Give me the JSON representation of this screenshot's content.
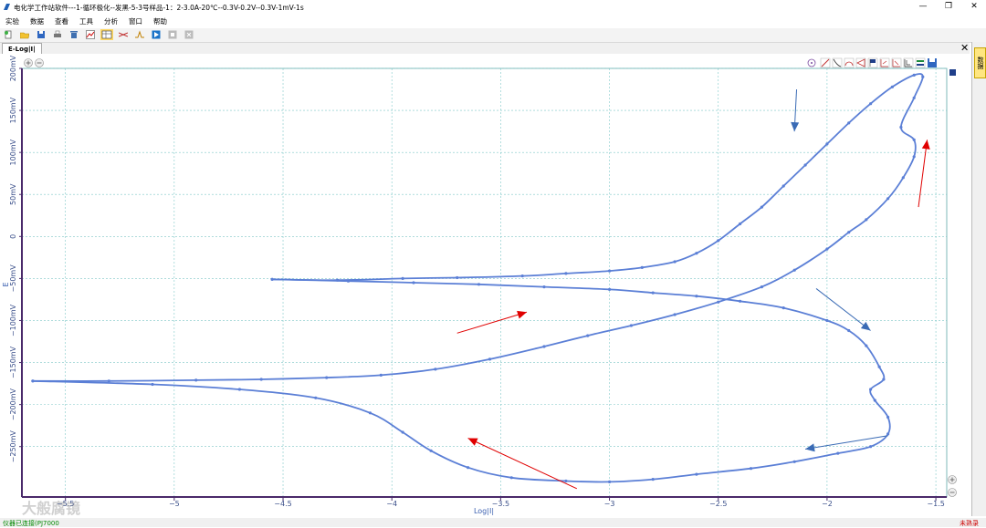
{
  "window": {
    "title": "电化学工作站软件---1-循环极化--发黑-5-3号样品-1：2-3.0A-20℃--0.3V-0.2V--0.3V-1mV-1s",
    "minimize_glyph": "—",
    "restore_glyph": "❐",
    "close_glyph": "✕"
  },
  "menu": [
    "实验",
    "数据",
    "查看",
    "工具",
    "分析",
    "窗口",
    "帮助"
  ],
  "toolbar_icons": [
    "new-icon",
    "open-folder-icon",
    "save-icon",
    "print-icon",
    "delete-icon",
    "chart-icon",
    "table-icon",
    "fit-icon",
    "peak-icon",
    "run-icon",
    "stop-icon",
    "close-file-icon"
  ],
  "tab": {
    "label": "E-Log|I|",
    "close_glyph": "✕"
  },
  "side_panel": {
    "label": "数据"
  },
  "watermark": "大般腐镜",
  "status": {
    "left": "仪器已连接(PJ7000",
    "right": "未熟录"
  },
  "chart_data": {
    "type": "line",
    "xlabel": "Log|I|",
    "ylabel": "E",
    "xlim": [
      -5.7,
      -1.45
    ],
    "ylim": [
      -310,
      200
    ],
    "x_ticks": [
      -5.5,
      -5,
      -4.5,
      -4,
      -3.5,
      -3,
      -2.5,
      -2,
      -1.5
    ],
    "x_tick_labels": [
      "−5.5",
      "−5",
      "−4.5",
      "−4",
      "−3.5",
      "−3",
      "−2.5",
      "−2",
      "−1.5"
    ],
    "y_ticks": [
      200,
      150,
      100,
      50,
      0,
      -50,
      -100,
      -150,
      -200,
      -250
    ],
    "y_tick_labels": [
      "200mV",
      "150mV",
      "100mV",
      "50mV",
      "0",
      "−50mV",
      "−100mV",
      "−150mV",
      "−200mV",
      "−250mV"
    ],
    "grid": true,
    "line_color": "#5b7fd6",
    "series": [
      {
        "values": [
          [
            -4.55,
            -51
          ],
          [
            -4.25,
            -52
          ],
          [
            -3.95,
            -50
          ],
          [
            -3.7,
            -49
          ],
          [
            -3.4,
            -47
          ],
          [
            -3.2,
            -44
          ],
          [
            -3.0,
            -41
          ],
          [
            -2.85,
            -37
          ],
          [
            -2.7,
            -30
          ],
          [
            -2.6,
            -20
          ],
          [
            -2.5,
            -5
          ],
          [
            -2.4,
            15
          ],
          [
            -2.3,
            35
          ],
          [
            -2.2,
            60
          ],
          [
            -2.1,
            85
          ],
          [
            -2.0,
            110
          ],
          [
            -1.9,
            135
          ],
          [
            -1.8,
            158
          ],
          [
            -1.7,
            178
          ],
          [
            -1.6,
            192
          ],
          [
            -1.56,
            190
          ],
          [
            -1.6,
            165
          ],
          [
            -1.66,
            130
          ],
          [
            -1.6,
            115
          ],
          [
            -1.6,
            95
          ],
          [
            -1.65,
            70
          ],
          [
            -1.72,
            45
          ],
          [
            -1.82,
            20
          ],
          [
            -1.9,
            5
          ],
          [
            -2.0,
            -15
          ],
          [
            -2.15,
            -40
          ],
          [
            -2.3,
            -60
          ],
          [
            -2.5,
            -78
          ],
          [
            -2.7,
            -93
          ],
          [
            -2.9,
            -106
          ],
          [
            -3.1,
            -118
          ],
          [
            -3.3,
            -131
          ],
          [
            -3.55,
            -146
          ],
          [
            -3.8,
            -158
          ],
          [
            -4.05,
            -165
          ],
          [
            -4.3,
            -168
          ],
          [
            -4.6,
            -170
          ],
          [
            -4.9,
            -171
          ],
          [
            -5.3,
            -172
          ],
          [
            -5.65,
            -172
          ]
        ]
      },
      {
        "values": [
          [
            -4.55,
            -51
          ],
          [
            -4.2,
            -53
          ],
          [
            -3.9,
            -55
          ],
          [
            -3.6,
            -57
          ],
          [
            -3.3,
            -60
          ],
          [
            -3.0,
            -63
          ],
          [
            -2.8,
            -67
          ],
          [
            -2.6,
            -71
          ],
          [
            -2.4,
            -77
          ],
          [
            -2.2,
            -85
          ],
          [
            -2.0,
            -100
          ],
          [
            -1.9,
            -112
          ],
          [
            -1.82,
            -130
          ],
          [
            -1.76,
            -155
          ],
          [
            -1.74,
            -170
          ],
          [
            -1.8,
            -182
          ],
          [
            -1.78,
            -195
          ],
          [
            -1.72,
            -215
          ],
          [
            -1.72,
            -235
          ],
          [
            -1.8,
            -250
          ],
          [
            -1.95,
            -258
          ],
          [
            -2.15,
            -268
          ],
          [
            -2.35,
            -276
          ],
          [
            -2.6,
            -283
          ],
          [
            -2.8,
            -289
          ],
          [
            -3.0,
            -292
          ],
          [
            -3.2,
            -291
          ],
          [
            -3.45,
            -287
          ],
          [
            -3.65,
            -275
          ],
          [
            -3.82,
            -255
          ],
          [
            -3.95,
            -233
          ],
          [
            -4.1,
            -210
          ],
          [
            -4.35,
            -192
          ],
          [
            -4.7,
            -182
          ],
          [
            -5.1,
            -176
          ],
          [
            -5.65,
            -172
          ]
        ]
      }
    ],
    "annotations": [
      {
        "type": "arrow",
        "color": "#3a6bb5",
        "from": [
          -2.14,
          175
        ],
        "to": [
          -2.15,
          125
        ]
      },
      {
        "type": "arrow",
        "color": "#e00000",
        "from": [
          -1.58,
          35
        ],
        "to": [
          -1.54,
          115
        ]
      },
      {
        "type": "arrow",
        "color": "#3a6bb5",
        "from": [
          -2.05,
          -62
        ],
        "to": [
          -1.8,
          -112
        ]
      },
      {
        "type": "arrow",
        "color": "#3a6bb5",
        "from": [
          -1.72,
          -237
        ],
        "to": [
          -2.1,
          -253
        ]
      },
      {
        "type": "arrow",
        "color": "#e00000",
        "from": [
          -3.7,
          -115
        ],
        "to": [
          -3.38,
          -90
        ]
      },
      {
        "type": "arrow",
        "color": "#e00000",
        "from": [
          -3.15,
          -300
        ],
        "to": [
          -3.65,
          -240
        ]
      }
    ]
  }
}
